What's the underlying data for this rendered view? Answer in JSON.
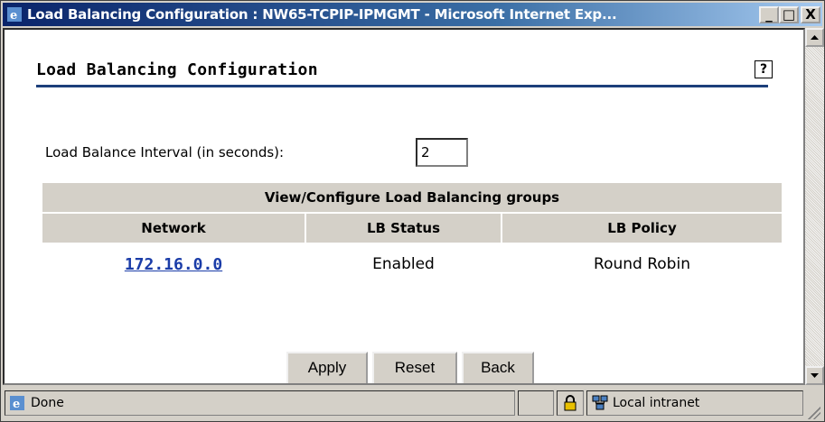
{
  "window": {
    "title": "Load Balancing Configuration : NW65-TCPIP-IPMGMT - Microsoft Internet Exp...",
    "minimize_label": "_",
    "maximize_label": "□",
    "close_label": "X"
  },
  "page": {
    "heading": "Load Balancing Configuration",
    "help_label": "?"
  },
  "interval": {
    "label": "Load Balance Interval (in seconds):",
    "value": "2"
  },
  "groups_table": {
    "caption": "View/Configure Load Balancing groups",
    "columns": [
      "Network",
      "LB Status",
      "LB Policy"
    ],
    "rows": [
      {
        "network": "172.16.0.0",
        "status": "Enabled",
        "policy": "Round Robin"
      }
    ]
  },
  "buttons": {
    "apply": "Apply",
    "reset": "Reset",
    "back": "Back"
  },
  "statusbar": {
    "status": "Done",
    "zone": "Local intranet"
  },
  "colors": {
    "titlebar": "#0a246a",
    "accent_rule": "#1c3f7a",
    "link": "#1a3ca8",
    "table_header_bg": "#d4d0c8"
  },
  "icons": [
    "ie-icon",
    "help-icon",
    "lock-icon",
    "intranet-icon"
  ]
}
